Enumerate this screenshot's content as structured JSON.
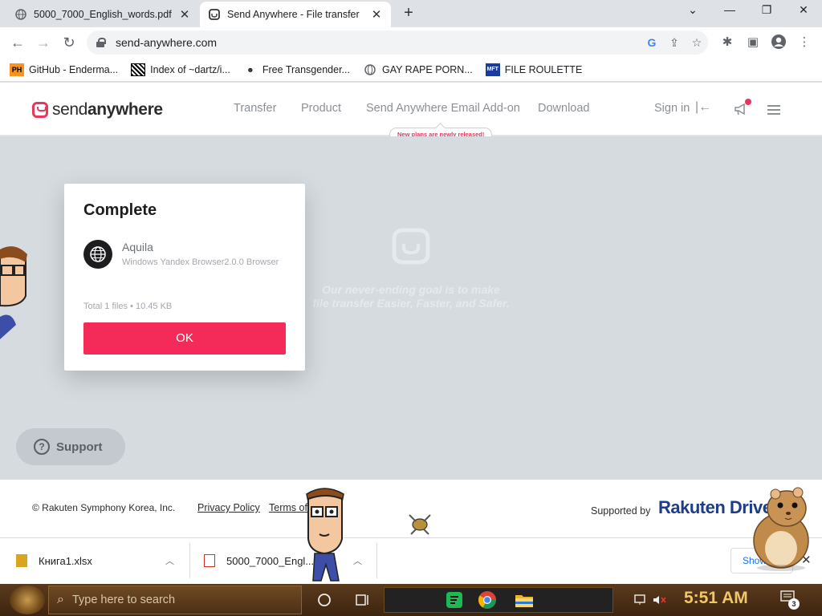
{
  "browser": {
    "tabs": [
      {
        "title": "5000_7000_English_words.pdf",
        "icon": "globe-icon"
      },
      {
        "title": "Send Anywhere - File transfer",
        "icon": "sendanywhere-icon"
      }
    ],
    "url": "send-anywhere.com",
    "bookmarks": [
      {
        "label": "GitHub - Enderma...",
        "icon": "PH"
      },
      {
        "label": "Index of ~dartz/i...",
        "icon": "qr"
      },
      {
        "label": "Free Transgender...",
        "icon": "mask"
      },
      {
        "label": "GAY RAPE PORN...",
        "icon": "globe"
      },
      {
        "label": "FILE ROULETTE",
        "icon": "MFT"
      }
    ]
  },
  "site": {
    "logo": {
      "light": "send",
      "bold": "anywhere"
    },
    "nav": [
      "Transfer",
      "Product",
      "Send Anywhere Email Add-on",
      "Download"
    ],
    "badge": "New plans are newly released!",
    "signin": "Sign in",
    "slogan_line1": "Our never-ending goal is to make",
    "slogan_line2": "file transfer Easier, Faster, and Safer.",
    "support": "Support",
    "accent": "#f42b58"
  },
  "dialog": {
    "title": "Complete",
    "sender": "Aquila",
    "device": "Windows Yandex Browser2.0.0 Browser",
    "total": "Total 1 files • 10.45 KB",
    "ok": "OK"
  },
  "footer": {
    "copyright": "© Rakuten Symphony Korea, Inc.",
    "privacy": "Privacy Policy",
    "terms": "Terms of",
    "supported_by": "Supported by",
    "brand": "Rakuten Drive"
  },
  "downloads": {
    "items": [
      {
        "name": "Книга1.xlsx"
      },
      {
        "name": "5000_7000_Engl..."
      }
    ],
    "show_all": "Show all"
  },
  "taskbar": {
    "search_placeholder": "Type here to search",
    "time": "5:51 AM",
    "notification_count": "3"
  }
}
